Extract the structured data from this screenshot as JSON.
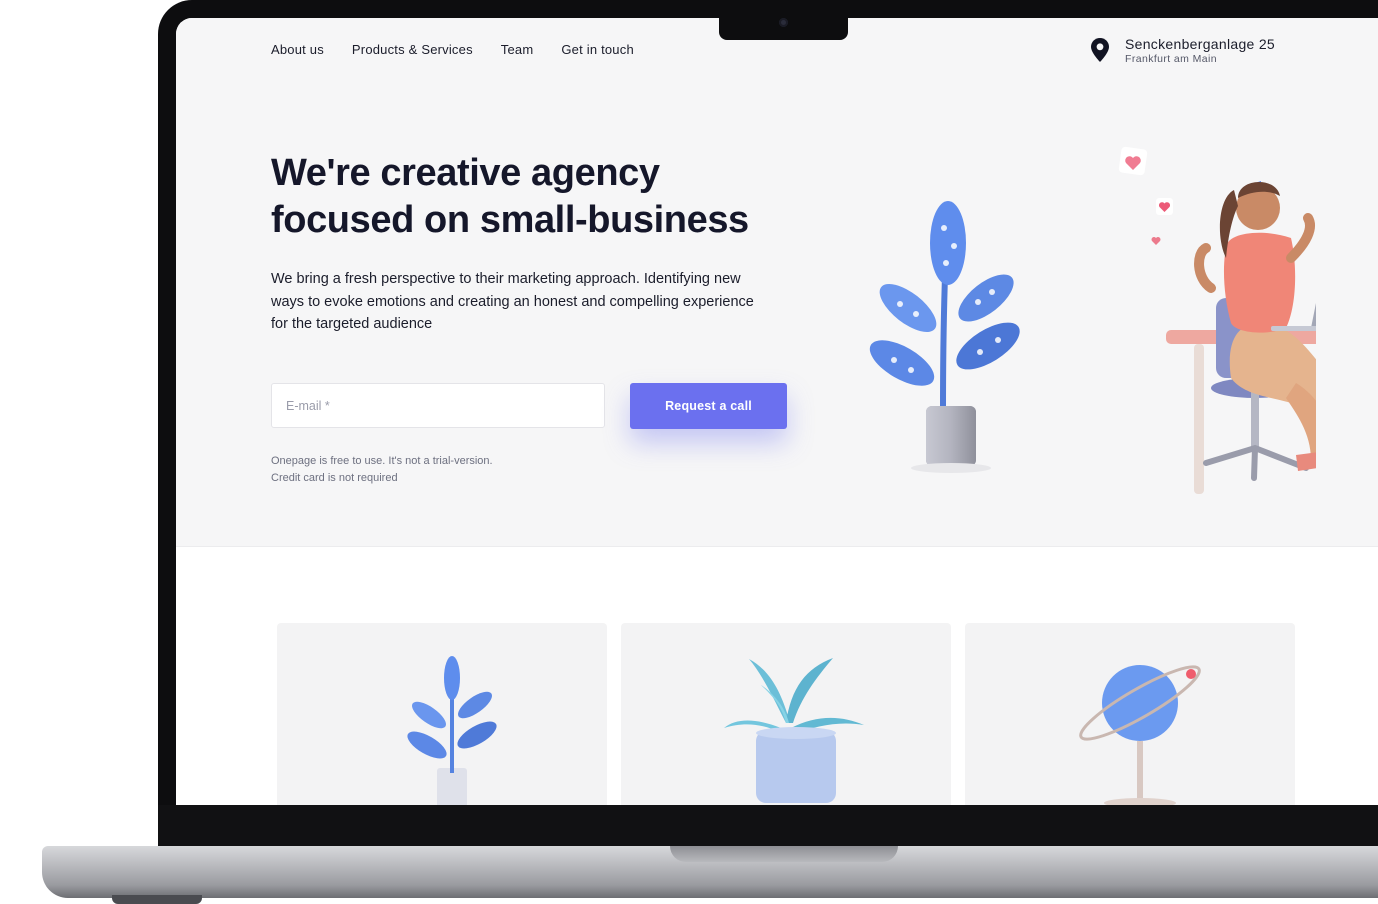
{
  "nav": {
    "items": [
      {
        "label": "About us"
      },
      {
        "label": "Products & Services"
      },
      {
        "label": "Team"
      },
      {
        "label": "Get in touch"
      }
    ]
  },
  "address": {
    "street": "Senckenberganlage 25",
    "city": "Frankfurt am Main",
    "icon": "location-pin-icon"
  },
  "hero": {
    "headline_line1": "We're creative agency",
    "headline_line2": "focused on small-business",
    "description": "We bring a fresh perspective to their marketing approach. Identifying new ways to evoke emotions and creating an honest and compelling experience for the targeted audience",
    "email_placeholder": "E-mail *",
    "cta_label": "Request a call",
    "note_line1": "Onepage is free to use. It's not a trial-version.",
    "note_line2": "Credit card is not required"
  },
  "colors": {
    "accent": "#6b70ef",
    "hero_bg": "#f6f6f7",
    "text": "#15172a"
  },
  "cards": [
    {
      "icon": "plant-icon"
    },
    {
      "icon": "potted-plant-icon"
    },
    {
      "icon": "planet-globe-icon"
    }
  ]
}
